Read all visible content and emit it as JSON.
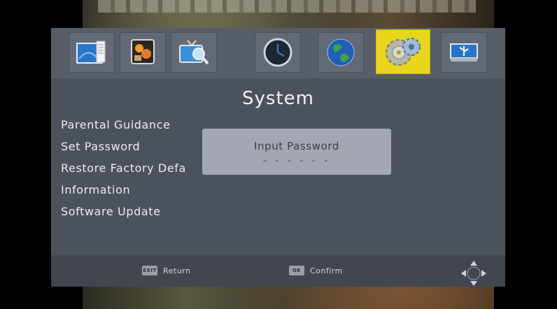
{
  "screen": {
    "title": "System",
    "tabs": [
      {
        "icon": "program-editor-icon",
        "active": false
      },
      {
        "icon": "picture-icon",
        "active": false
      },
      {
        "icon": "channel-search-icon",
        "active": false
      },
      {
        "icon": "clock-icon",
        "active": false
      },
      {
        "icon": "globe-language-icon",
        "active": false
      },
      {
        "icon": "system-gears-icon",
        "active": true
      },
      {
        "icon": "usb-icon",
        "active": false
      }
    ],
    "accent_color": "#e8d51c"
  },
  "menu": {
    "items": [
      {
        "label": "Parental Guidance"
      },
      {
        "label": "Set Password"
      },
      {
        "label": "Restore Factory Defa"
      },
      {
        "label": "Information"
      },
      {
        "label": "Software Update"
      }
    ]
  },
  "dialog": {
    "title": "Input Password",
    "value": "- - - - - -"
  },
  "footer": {
    "return_key": "EXIT",
    "return_label": "Return",
    "confirm_key": "OK",
    "confirm_label": "Confirm",
    "nav_icon": "dpad-navigation-icon"
  }
}
